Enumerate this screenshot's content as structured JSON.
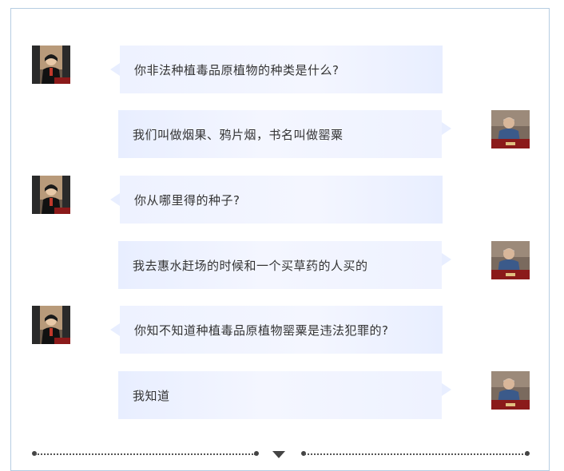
{
  "colors": {
    "frame_border": "#b6cde2",
    "bubble_bg": "#eef2ff",
    "text": "#333333"
  },
  "messages": [
    {
      "speaker": "judge",
      "side": "left",
      "text": "你非法种植毒品原植物的种类是什么?"
    },
    {
      "speaker": "defendant",
      "side": "right",
      "text": "我们叫做烟果、鸦片烟，书名叫做罂粟"
    },
    {
      "speaker": "judge",
      "side": "left",
      "text": "你从哪里得的种子?"
    },
    {
      "speaker": "defendant",
      "side": "right",
      "text": "我去惠水赶场的时候和一个买草药的人买的"
    },
    {
      "speaker": "judge",
      "side": "left",
      "text": "你知不知道种植毒品原植物罂粟是违法犯罪的?"
    },
    {
      "speaker": "defendant",
      "side": "right",
      "text": "我知道"
    }
  ]
}
